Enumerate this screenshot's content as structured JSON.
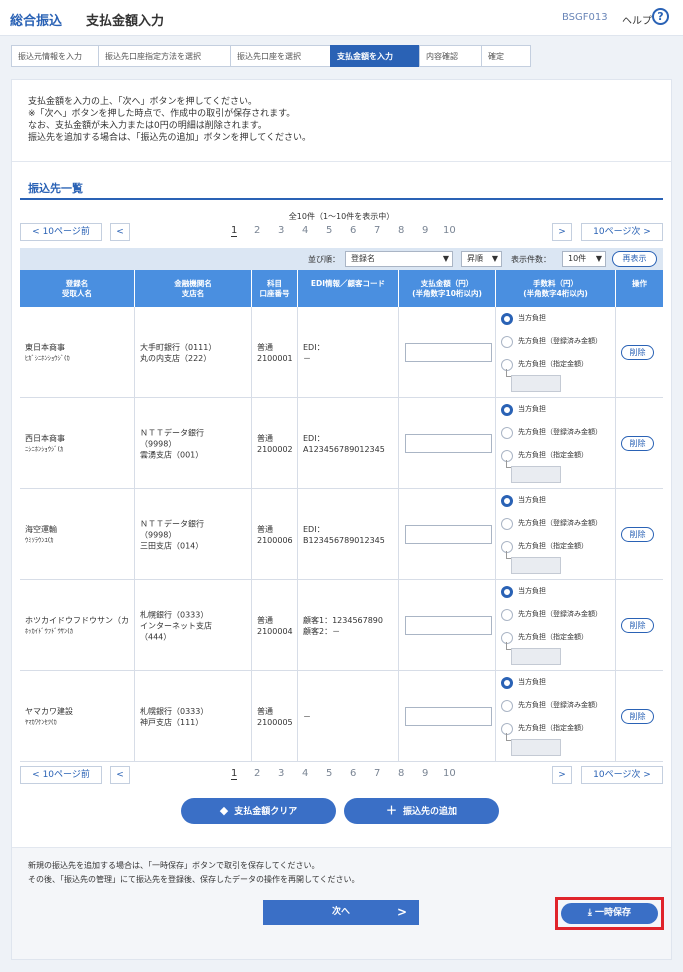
{
  "header": {
    "title": "総合振込",
    "subtitle": "支払金額入力",
    "screen_code": "BSGF013",
    "help_label": "ヘルプ",
    "help_icon": "?"
  },
  "steps": [
    {
      "label": "振込元情報を入力",
      "active": false
    },
    {
      "label": "振込先口座指定方法を選択",
      "active": false
    },
    {
      "label": "振込先口座を選択",
      "active": false
    },
    {
      "label": "支払金額を入力",
      "active": true
    },
    {
      "label": "内容確認",
      "active": false
    },
    {
      "label": "確定",
      "active": false
    }
  ],
  "instructions": [
    "支払金額を入力の上、「次へ」ボタンを押してください。",
    "※「次へ」ボタンを押した時点で、作成中の取引が保存されます。",
    "なお、支払金額が未入力または0円の明細は削除されます。",
    "振込先を追加する場合は、「振込先の追加」ボタンを押してください。"
  ],
  "section_title": "振込先一覧",
  "count_text": "全10件（1～10件を表示中）",
  "pager": {
    "prev10": "10ページ前",
    "prev_icon": "<",
    "next10": "10ページ次",
    "next_icon": ">",
    "pages": [
      "1",
      "2",
      "3",
      "4",
      "5",
      "6",
      "7",
      "8",
      "9",
      "10"
    ]
  },
  "sort": {
    "sort_label": "並び順：",
    "sort_value": "登録名",
    "order_value": "昇順",
    "per_page_label": "表示件数：",
    "per_page_value": "10件",
    "redisplay": "再表示",
    "arrow": "▼"
  },
  "columns": [
    "登録名\n受取人名",
    "金融機関名\n支店名",
    "科目\n口座番号",
    "EDI情報／顧客コード",
    "支払金額（円）\n(半角数字10桁以内)",
    "手数料（円）\n(半角数字4桁以内)",
    "操作"
  ],
  "fee_options": [
    "当方負担",
    "先方負担（登録済み金額）",
    "先方負担（指定金額）"
  ],
  "delete_label": "削除",
  "rows": [
    {
      "name": "東日本商事",
      "kana": "ﾋｶﾞｼﾆﾎﾝｼｮｳｼﾞ(ｶ",
      "bank": [
        "大手町銀行（0111）",
        "丸の内支店（222）"
      ],
      "type": "普通",
      "account": "2100001",
      "edi": [
        "EDI：",
        "－"
      ]
    },
    {
      "name": "西日本商事",
      "kana": "ﾆｼﾆﾎﾝｼｮｳｼﾞ(ｶ",
      "bank": [
        "ＮＴＴデータ銀行",
        "（9998）",
        "雲湧支店（001）"
      ],
      "type": "普通",
      "account": "2100002",
      "edi": [
        "EDI：",
        "A123456789012345"
      ]
    },
    {
      "name": "海空運輸",
      "kana": "ｳﾐｿﾗｳﾝﾕ(ｶ",
      "bank": [
        "ＮＴＴデータ銀行",
        "（9998）",
        "三田支店（014）"
      ],
      "type": "普通",
      "account": "2100006",
      "edi": [
        "EDI：",
        "B123456789012345"
      ]
    },
    {
      "name": "ホツカイドウフドウサン（カ",
      "kana": "ﾎｯｶｲﾄﾞｳﾌﾄﾞｳｻﾝ(ｶ",
      "bank": [
        "札幌銀行（0333）",
        "インターネット支店",
        "（444）"
      ],
      "type": "普通",
      "account": "2100004",
      "edi": [
        "顧客1：1234567890",
        "顧客2：－"
      ]
    },
    {
      "name": "ヤマカワ建設",
      "kana": "ﾔﾏｶﾜｹﾝｾﾂ(ｶ",
      "bank": [
        "札幌銀行（0333）",
        "神戸支店（111）"
      ],
      "type": "普通",
      "account": "2100005",
      "edi": [
        "－"
      ]
    }
  ],
  "buttons": {
    "clear": "支払金額クリア",
    "add": "振込先の追加",
    "next": "次へ",
    "save": "一時保存"
  },
  "notes": [
    "新規の振込先を追加する場合は、「一時保存」ボタンで取引を保存してください。",
    "その後、「振込先の管理」にて振込先を登録後、保存したデータの操作を再開してください。"
  ]
}
